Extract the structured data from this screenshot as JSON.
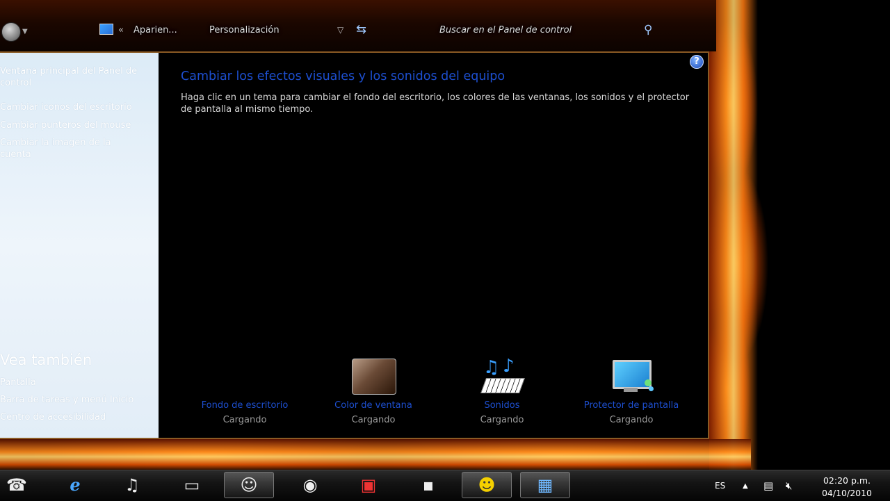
{
  "address_bar": {
    "crumb_1": "Aparien...",
    "crumb_2": "Personalización",
    "search_placeholder": "Buscar en el Panel de control"
  },
  "sidebar": {
    "links": [
      "Ventana principal del Panel de control",
      "Cambiar iconos del escritorio",
      "Cambiar punteros del mouse",
      "Cambiar la imagen de la cuenta"
    ],
    "see_also_heading": "Vea también",
    "see_also": [
      "Pantalla",
      "Barra de tareas y menú Inicio",
      "Centro de accesibilidad"
    ]
  },
  "main": {
    "title": "Cambiar los efectos visuales y los sonidos del equipo",
    "description": "Haga clic en un tema para cambiar el fondo del escritorio, los colores de las ventanas, los sonidos y el protector de pantalla al mismo tiempo.",
    "help_glyph": "?",
    "tiles": [
      {
        "name": "Fondo de escritorio",
        "status": "Cargando",
        "icon": "wallpaper-icon"
      },
      {
        "name": "Color de ventana",
        "status": "Cargando",
        "icon": "window-color-icon"
      },
      {
        "name": "Sonidos",
        "status": "Cargando",
        "icon": "sounds-icon"
      },
      {
        "name": "Protector de pantalla",
        "status": "Cargando",
        "icon": "screensaver-icon"
      }
    ]
  },
  "taskbar": {
    "language": "ES",
    "time": "02:20 p.m.",
    "date": "04/10/2010"
  }
}
